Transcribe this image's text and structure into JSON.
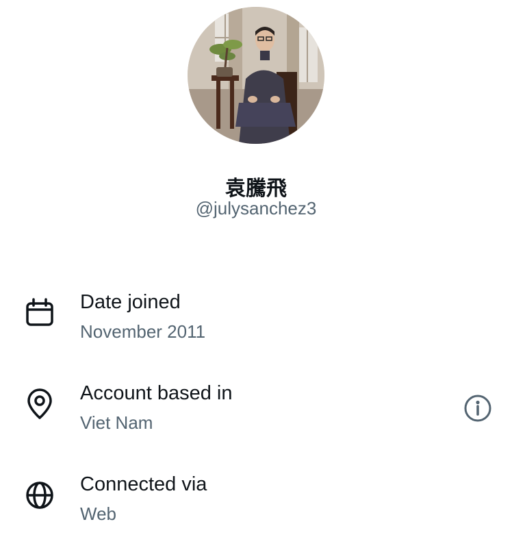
{
  "profile": {
    "display_name": "袁騰飛",
    "handle": "@julysanchez3"
  },
  "rows": [
    {
      "icon": "calendar-icon",
      "title": "Date joined",
      "value": "November 2011"
    },
    {
      "icon": "location-pin-icon",
      "title": "Account based in",
      "value": "Viet Nam"
    },
    {
      "icon": "globe-icon",
      "title": "Connected via",
      "value": "Web"
    }
  ],
  "info_icon": "info-icon",
  "colors": {
    "text_primary": "#0f1419",
    "text_secondary": "#536471",
    "background": "#ffffff"
  }
}
